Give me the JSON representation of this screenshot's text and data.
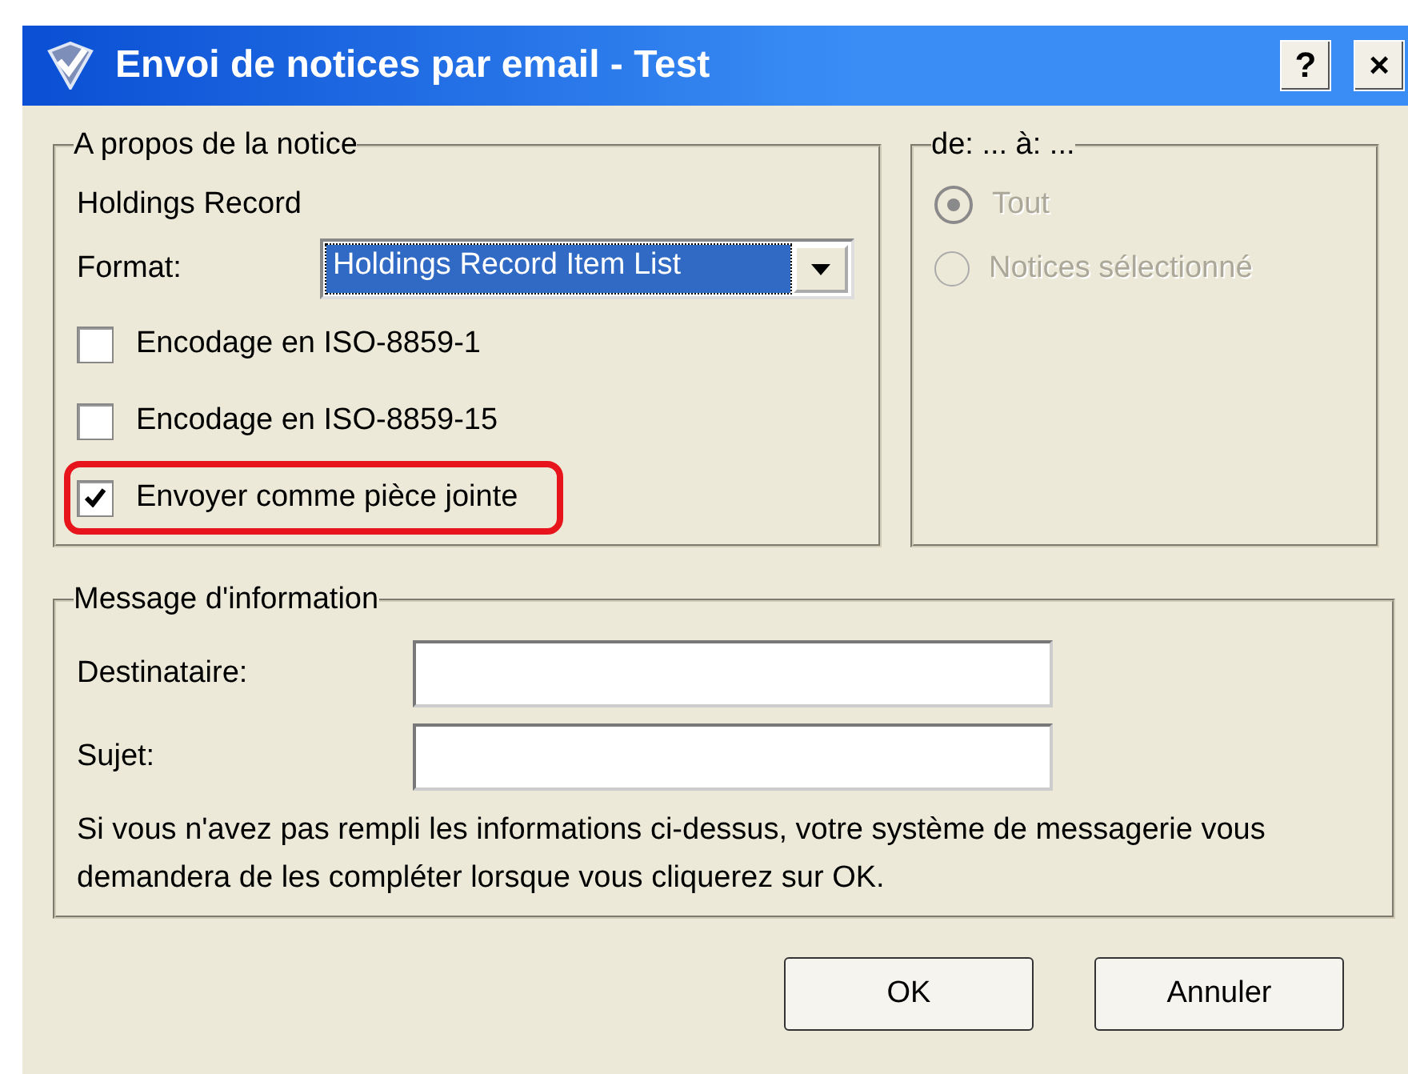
{
  "window": {
    "title": "Envoi de notices par email - Test",
    "buttons": [
      "?",
      "×"
    ]
  },
  "about": {
    "legend": "A propos de la notice",
    "record_type": "Holdings Record",
    "format_label": "Format:",
    "format_value": "Holdings Record Item List",
    "options": [
      {
        "label": "Encodage en ISO-8859-1",
        "checked": false,
        "highlighted": false
      },
      {
        "label": "Encodage en ISO-8859-15",
        "checked": false,
        "highlighted": false
      },
      {
        "label": "Envoyer comme pièce jointe",
        "checked": true,
        "highlighted": true
      }
    ]
  },
  "range": {
    "legend": "de: ... à: ...",
    "disabled": true,
    "options": [
      {
        "label": "Tout",
        "selected": true
      },
      {
        "label": "Notices sélectionné",
        "selected": false
      }
    ]
  },
  "message": {
    "legend": "Message d'information",
    "fields": [
      {
        "label": "Destinataire:"
      },
      {
        "label": "Sujet:"
      }
    ],
    "note": "Si vous n'avez pas rempli les informations ci-dessus, votre système de messagerie vous demandera de les compléter lorsque vous cliquerez sur OK."
  },
  "buttons": [
    "OK",
    "Annuler"
  ]
}
